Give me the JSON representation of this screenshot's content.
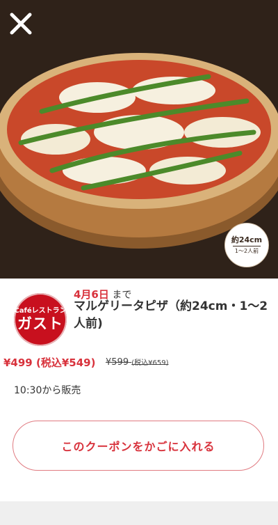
{
  "hero": {
    "close_icon": "close-icon",
    "size_badge": {
      "size": "約24cm",
      "servings": "1〜2人前"
    }
  },
  "coupon": {
    "logo": {
      "small": "Caféレストラン",
      "big": "ガスト"
    },
    "deadline_date": "4月6日",
    "deadline_suffix": "まで",
    "product_name": "マルゲリータピザ（約24cm・1〜2人前)",
    "price": "¥499 (税込¥549)",
    "old_price": "¥599",
    "old_price_tax": "(税込¥659)",
    "sale_time": "10:30から販売",
    "button_label": "このクーポンをかごに入れる"
  },
  "colors": {
    "accent": "#d8323c",
    "logo_red": "#c8101e"
  }
}
